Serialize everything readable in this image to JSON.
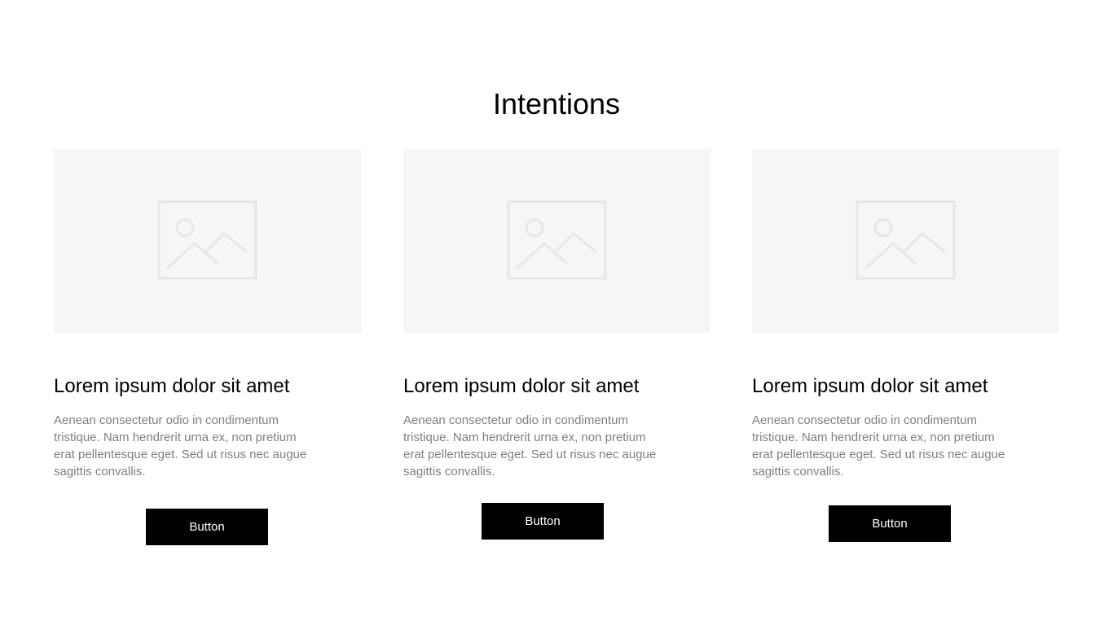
{
  "section": {
    "title": "Intentions"
  },
  "cards": [
    {
      "image_icon": "image-placeholder-icon",
      "title": "Lorem ipsum dolor sit amet",
      "text": "Aenean consectetur odio in condimentum tristique. Nam hendrerit urna ex, non pretium erat pellentesque eget. Sed ut risus nec augue sagittis convallis.",
      "button_label": "Button"
    },
    {
      "image_icon": "image-placeholder-icon",
      "title": "Lorem ipsum dolor sit amet",
      "text": "Aenean consectetur odio in condimentum tristique. Nam hendrerit urna ex, non pretium erat pellentesque eget. Sed ut risus nec augue sagittis convallis.",
      "button_label": "Button"
    },
    {
      "image_icon": "image-placeholder-icon",
      "title": "Lorem ipsum dolor sit amet",
      "text": "Aenean consectetur odio in condimentum tristique. Nam hendrerit urna ex, non pretium erat pellentesque eget. Sed ut risus nec augue sagittis convallis.",
      "button_label": "Button"
    }
  ],
  "colors": {
    "image_background": "#f5f6f8",
    "placeholder_stroke": "#e6e7ea",
    "body_text": "#7f7f7f",
    "button_background": "#000000",
    "button_text": "#ffffff"
  }
}
